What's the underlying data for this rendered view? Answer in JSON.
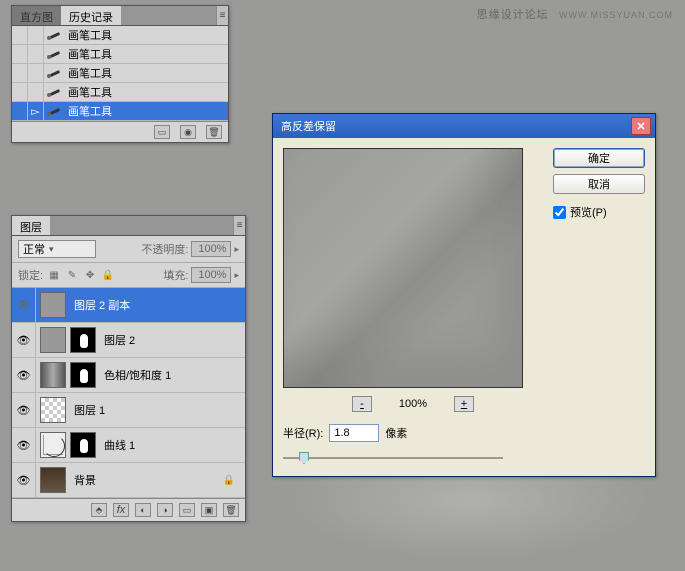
{
  "watermark": {
    "main": "思缘设计论坛",
    "sub": "WWW.MISSYUAN.COM"
  },
  "history": {
    "tab_inactive": "直方图",
    "tab_active": "历史记录",
    "items": [
      {
        "label": "画笔工具",
        "sel": false
      },
      {
        "label": "画笔工具",
        "sel": false
      },
      {
        "label": "画笔工具",
        "sel": false
      },
      {
        "label": "画笔工具",
        "sel": false
      },
      {
        "label": "画笔工具",
        "sel": true
      }
    ]
  },
  "layers": {
    "tab": "图层",
    "mode_label": "正常",
    "opacity_label": "不透明度:",
    "opacity_value": "100%",
    "lock_label": "锁定:",
    "fill_label": "填充:",
    "fill_value": "100%",
    "items": [
      {
        "name": "图层 2 副本",
        "sel": true,
        "thumb": "gray",
        "mask": false,
        "lock": false
      },
      {
        "name": "图层 2",
        "sel": false,
        "thumb": "gray",
        "mask": true,
        "lock": false
      },
      {
        "name": "色相/饱和度 1",
        "sel": false,
        "thumb": "hs",
        "mask": true,
        "lock": false
      },
      {
        "name": "图层 1",
        "sel": false,
        "thumb": "checker",
        "mask": false,
        "lock": false
      },
      {
        "name": "曲线 1",
        "sel": false,
        "thumb": "curves",
        "mask": true,
        "lock": false
      },
      {
        "name": "背景",
        "sel": false,
        "thumb": "photo",
        "mask": false,
        "lock": true
      }
    ]
  },
  "dialog": {
    "title": "高反差保留",
    "ok": "确定",
    "cancel": "取消",
    "preview": "预览(P)",
    "zoom": "100%",
    "radius_label": "半径(R):",
    "radius_value": "1.8",
    "radius_unit": "像素"
  }
}
